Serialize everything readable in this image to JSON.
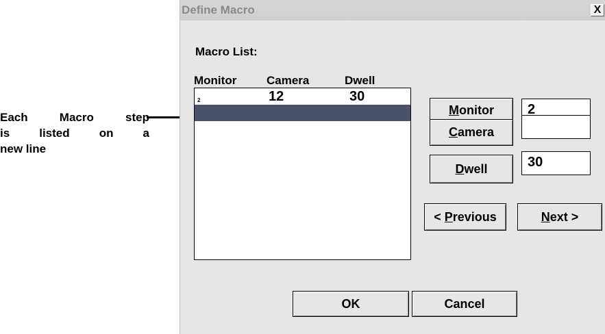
{
  "callout": {
    "line1_a": "Each",
    "line1_b": "Macro",
    "line1_c": "step",
    "line2_a": "is",
    "line2_b": "listed",
    "line2_c": "on",
    "line2_d": "a",
    "line3": "new line"
  },
  "dialog": {
    "title": "Define Macro",
    "close_label": "X",
    "macro_list_label": "Macro List:",
    "columns": [
      "Monitor",
      "Camera",
      "Dwell"
    ],
    "rows": [
      {
        "monitor": "2",
        "camera": "12",
        "dwell": "30"
      },
      {
        "monitor": "",
        "camera": "",
        "dwell": "",
        "selected": true
      }
    ],
    "buttons": {
      "monitor": {
        "mnemonic": "M",
        "rest": "onitor"
      },
      "camera": {
        "mnemonic": "C",
        "rest": "amera"
      },
      "dwell": {
        "mnemonic": "D",
        "rest": "well"
      },
      "previous": {
        "prefix": "< ",
        "mnemonic": "P",
        "rest": "revious"
      },
      "next": {
        "mnemonic": "N",
        "rest": "ext >"
      },
      "ok": "OK",
      "cancel": "Cancel"
    },
    "fields": {
      "monitor_value": "2",
      "camera_value": "",
      "dwell_value": "30"
    }
  },
  "colors": {
    "selection": "#4a5168",
    "dialog_bg": "#e6e6e6",
    "title_text": "#8a8a8a"
  }
}
